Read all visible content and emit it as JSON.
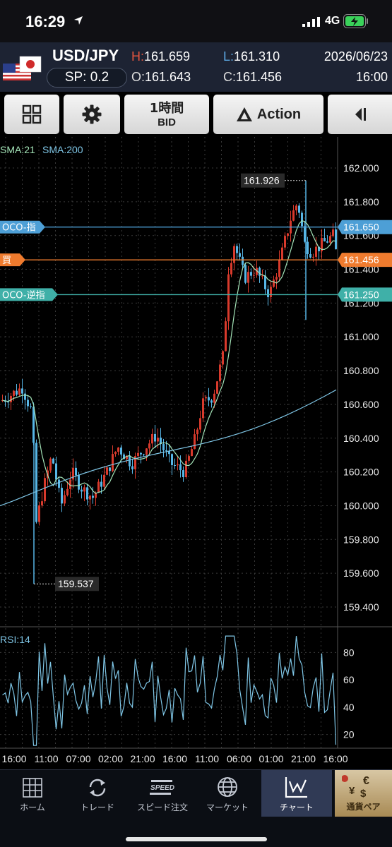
{
  "status_bar": {
    "time": "16:29",
    "network": "4G"
  },
  "header": {
    "pair": "USD/JPY",
    "spread": "SP: 0.2",
    "high_label": "H:",
    "high": "161.659",
    "low_label": "L:",
    "low": "161.310",
    "open_label": "O:",
    "open": "161.643",
    "close_label": "C:",
    "close": "161.456",
    "date": "2026/06/23",
    "time": "16:00"
  },
  "toolbar": {
    "layout_icon": "grid-icon",
    "settings_icon": "gear-icon",
    "timeframe": "1時間",
    "price_type": "BID",
    "action_label": "Action",
    "collapse_icon": "collapse-right-icon"
  },
  "chart": {
    "indicators": {
      "sma_short": "SMA:21",
      "sma_long": "SMA:200",
      "rsi": "RSI:14"
    },
    "colors": {
      "up": "#d83a2c",
      "down": "#57b6e6",
      "sma_short": "#a4e4b8",
      "sma_long": "#7fc6e6",
      "rsi": "#7fc6e6",
      "oco": "#4d9fd6",
      "buy": "#ef7b2e",
      "stop": "#3fb0a8"
    },
    "y_axis_ticks": [
      "162.000",
      "161.800",
      "161.600",
      "161.400",
      "161.200",
      "161.000",
      "160.800",
      "160.600",
      "160.400",
      "160.200",
      "160.000",
      "159.800",
      "159.600",
      "159.400"
    ],
    "rsi_ticks": [
      "80",
      "60",
      "40",
      "20"
    ],
    "x_axis_ticks": [
      "16:00",
      "11:00",
      "07:00",
      "02:00",
      "21:00",
      "16:00",
      "11:00",
      "06:00",
      "01:00",
      "21:00",
      "16:00"
    ],
    "order_lines": [
      {
        "tag": "OCO-指",
        "price": "161.650",
        "value": 161.65,
        "kind": "oco"
      },
      {
        "tag": "買",
        "price": "161.456",
        "value": 161.456,
        "kind": "buy"
      },
      {
        "tag": "OCO-逆指",
        "price": "161.250",
        "value": 161.25,
        "kind": "stop"
      }
    ],
    "high_marker": "161.926",
    "low_marker": "159.537"
  },
  "chart_data": {
    "type": "candlestick",
    "title": "USD/JPY",
    "timeframe": "1時間",
    "y_range": [
      159.3,
      162.1
    ],
    "high": 161.926,
    "low": 159.537,
    "last": 161.456,
    "rsi_range": [
      0,
      100
    ],
    "sma200_start": 160.0,
    "sma200_end": 160.7,
    "grid": true
  },
  "bottom_nav": {
    "items": [
      {
        "label": "ホーム",
        "icon": "home-grid-icon"
      },
      {
        "label": "トレード",
        "icon": "trade-arrows-icon"
      },
      {
        "label": "スピード注文",
        "icon": "speed-icon"
      },
      {
        "label": "マーケット",
        "icon": "globe-icon"
      },
      {
        "label": "チャート",
        "icon": "chart-icon"
      }
    ],
    "pair_label": "通貨ペア"
  }
}
